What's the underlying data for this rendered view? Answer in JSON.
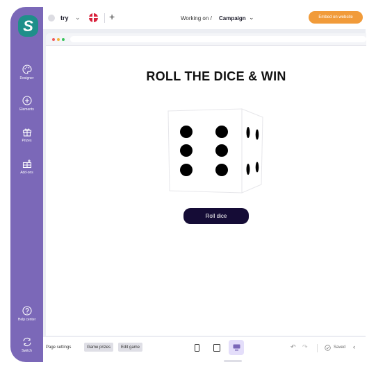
{
  "sidebar": {
    "logo_letter": "S",
    "items": [
      {
        "label": "Designer",
        "icon": "palette-icon"
      },
      {
        "label": "Elements",
        "icon": "plus-circle-icon"
      },
      {
        "label": "Prizes",
        "icon": "gift-icon"
      },
      {
        "label": "Add-ons",
        "icon": "add-ons-icon"
      }
    ],
    "help_label": "Help center",
    "switch_label": "Switch"
  },
  "topbar": {
    "project_name": "try",
    "working_on": "Working on",
    "separator": "/",
    "campaign": "Campaign",
    "plus": "+",
    "embed_label": "Embed on website"
  },
  "game": {
    "title": "ROLL THE DICE & WIN",
    "button_label": "Roll dice",
    "dice_front_value": 6
  },
  "bottombar": {
    "page_settings": "Page settings",
    "game_prizes": "Game prizes",
    "edit_game": "Edit game",
    "saved_label": "Saved",
    "active_device": "desktop"
  },
  "colors": {
    "sidebar": "#7b68b8",
    "logo": "#1f8f8a",
    "embed_button": "#f19b3a",
    "roll_button": "#150c36"
  }
}
